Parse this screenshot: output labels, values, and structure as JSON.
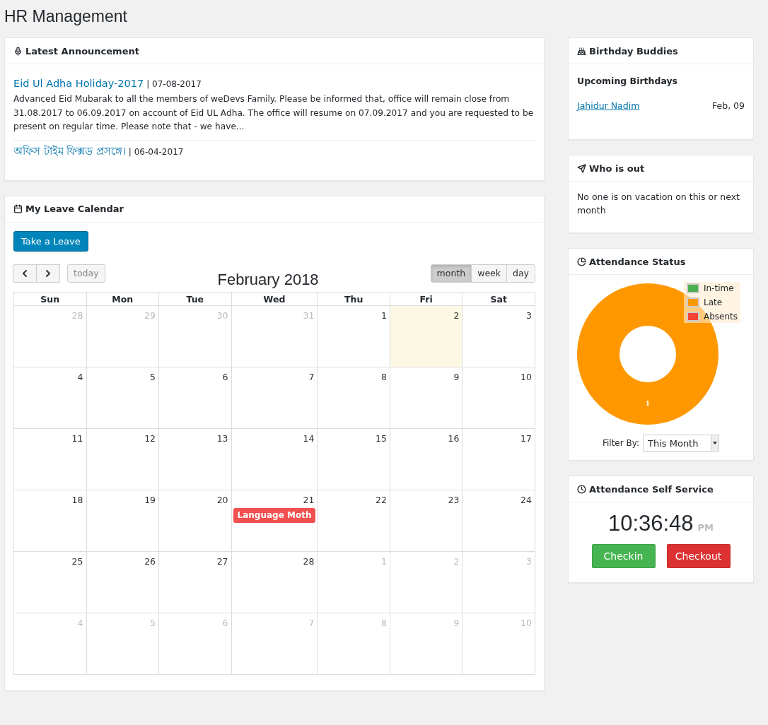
{
  "page_title": "HR Management",
  "announcements": {
    "title": "Latest Announcement",
    "items": [
      {
        "title": "Eid Ul Adha Holiday-2017",
        "date": "| 07-08-2017",
        "body": "Advanced Eid Mubarak to all the members of weDevs Family. Please be informed that, office will remain close from 31.08.2017 to 06.09.2017 on account of Eid UL Adha. The office will resume on 07.09.2017 and you are requested to be present on regular time. Please note that - we have..."
      },
      {
        "title": "অফিস টাইম ফিক্সড প্রসঙ্গে।",
        "date": "| 06-04-2017"
      }
    ]
  },
  "leave_calendar": {
    "title": "My Leave Calendar",
    "take_leave": "Take a Leave",
    "today": "today",
    "month_title": "February 2018",
    "views": [
      {
        "label": "month",
        "selected": true
      },
      {
        "label": "week",
        "selected": false
      },
      {
        "label": "day",
        "selected": false
      }
    ],
    "weekdays": [
      "Sun",
      "Mon",
      "Tue",
      "Wed",
      "Thu",
      "Fri",
      "Sat"
    ],
    "weeks": [
      [
        {
          "day": "28",
          "other_month": true,
          "today": false
        },
        {
          "day": "29",
          "other_month": true,
          "today": false
        },
        {
          "day": "30",
          "other_month": true,
          "today": false
        },
        {
          "day": "31",
          "other_month": true,
          "today": false
        },
        {
          "day": "1",
          "other_month": false,
          "today": false
        },
        {
          "day": "2",
          "other_month": false,
          "today": true
        },
        {
          "day": "3",
          "other_month": false,
          "today": false
        }
      ],
      [
        {
          "day": "4",
          "other_month": false,
          "today": false
        },
        {
          "day": "5",
          "other_month": false,
          "today": false
        },
        {
          "day": "6",
          "other_month": false,
          "today": false
        },
        {
          "day": "7",
          "other_month": false,
          "today": false
        },
        {
          "day": "8",
          "other_month": false,
          "today": false
        },
        {
          "day": "9",
          "other_month": false,
          "today": false
        },
        {
          "day": "10",
          "other_month": false,
          "today": false
        }
      ],
      [
        {
          "day": "11",
          "other_month": false,
          "today": false
        },
        {
          "day": "12",
          "other_month": false,
          "today": false
        },
        {
          "day": "13",
          "other_month": false,
          "today": false
        },
        {
          "day": "14",
          "other_month": false,
          "today": false
        },
        {
          "day": "15",
          "other_month": false,
          "today": false
        },
        {
          "day": "16",
          "other_month": false,
          "today": false
        },
        {
          "day": "17",
          "other_month": false,
          "today": false
        }
      ],
      [
        {
          "day": "18",
          "other_month": false,
          "today": false
        },
        {
          "day": "19",
          "other_month": false,
          "today": false
        },
        {
          "day": "20",
          "other_month": false,
          "today": false
        },
        {
          "day": "21",
          "other_month": false,
          "today": false,
          "events": [
            {
              "title": "Language Moth",
              "color": "#f05050"
            }
          ]
        },
        {
          "day": "22",
          "other_month": false,
          "today": false
        },
        {
          "day": "23",
          "other_month": false,
          "today": false
        },
        {
          "day": "24",
          "other_month": false,
          "today": false
        }
      ],
      [
        {
          "day": "25",
          "other_month": false,
          "today": false
        },
        {
          "day": "26",
          "other_month": false,
          "today": false
        },
        {
          "day": "27",
          "other_month": false,
          "today": false
        },
        {
          "day": "28",
          "other_month": false,
          "today": false
        },
        {
          "day": "1",
          "other_month": true,
          "today": false
        },
        {
          "day": "2",
          "other_month": true,
          "today": false
        },
        {
          "day": "3",
          "other_month": true,
          "today": false
        }
      ],
      [
        {
          "day": "4",
          "other_month": true,
          "today": false
        },
        {
          "day": "5",
          "other_month": true,
          "today": false
        },
        {
          "day": "6",
          "other_month": true,
          "today": false
        },
        {
          "day": "7",
          "other_month": true,
          "today": false
        },
        {
          "day": "8",
          "other_month": true,
          "today": false
        },
        {
          "day": "9",
          "other_month": true,
          "today": false
        },
        {
          "day": "10",
          "other_month": true,
          "today": false
        }
      ]
    ]
  },
  "birthdays": {
    "title": "Birthday Buddies",
    "subtitle": "Upcoming Birthdays",
    "items": [
      {
        "name": "Jahidur Nadim",
        "date": "Feb, 09"
      }
    ]
  },
  "who_is_out": {
    "title": "Who is out",
    "message": "No one is on vacation on this or next month"
  },
  "attendance_status": {
    "title": "Attendance Status",
    "filter_label": "Filter By:",
    "filter_value": "This Month",
    "chart_data": {
      "type": "donut",
      "categories": [
        "In-time",
        "Late",
        "Absents"
      ],
      "series": [
        {
          "colors": [
            "#4caf50",
            "#ff9800",
            "#f44336"
          ],
          "values": [
            0,
            1,
            0
          ]
        }
      ],
      "data_labels": true
    }
  },
  "self_service": {
    "title": "Attendance Self Service",
    "time": "10:36:48",
    "meridiem": "PM",
    "checkin": "Checkin",
    "checkout": "Checkout"
  }
}
